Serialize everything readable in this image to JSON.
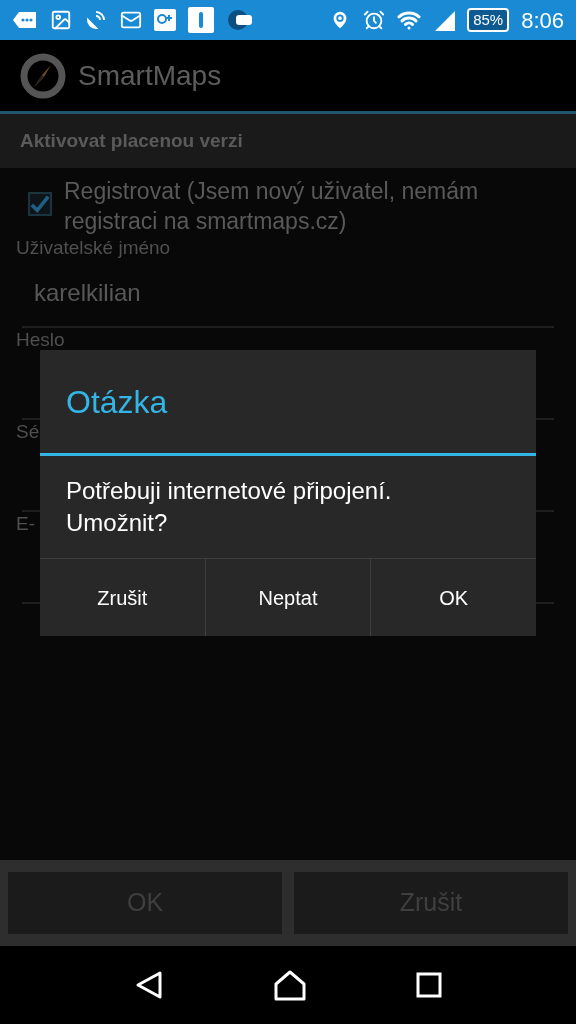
{
  "status_bar": {
    "battery": "85%",
    "time": "8:06"
  },
  "app_bar": {
    "title": "SmartMaps"
  },
  "section": {
    "title": "Aktivovat placenou verzi"
  },
  "register": {
    "label": "Registrovat (Jsem nový uživatel, nemám registraci na smartmaps.cz)",
    "checked": true
  },
  "fields": [
    {
      "label": "Uživatelské jméno",
      "value": "karelkilian"
    },
    {
      "label": "Heslo"
    },
    {
      "label": "Sé"
    },
    {
      "label": "E-"
    }
  ],
  "footer_buttons": [
    {
      "label": "OK",
      "disabled": true
    },
    {
      "label": "Zrušit",
      "disabled": true
    }
  ],
  "dialog": {
    "title": "Otázka",
    "message": "Potřebuji internetové připojení. Umožnit?",
    "buttons": [
      "Zrušit",
      "Neptat",
      "OK"
    ]
  }
}
